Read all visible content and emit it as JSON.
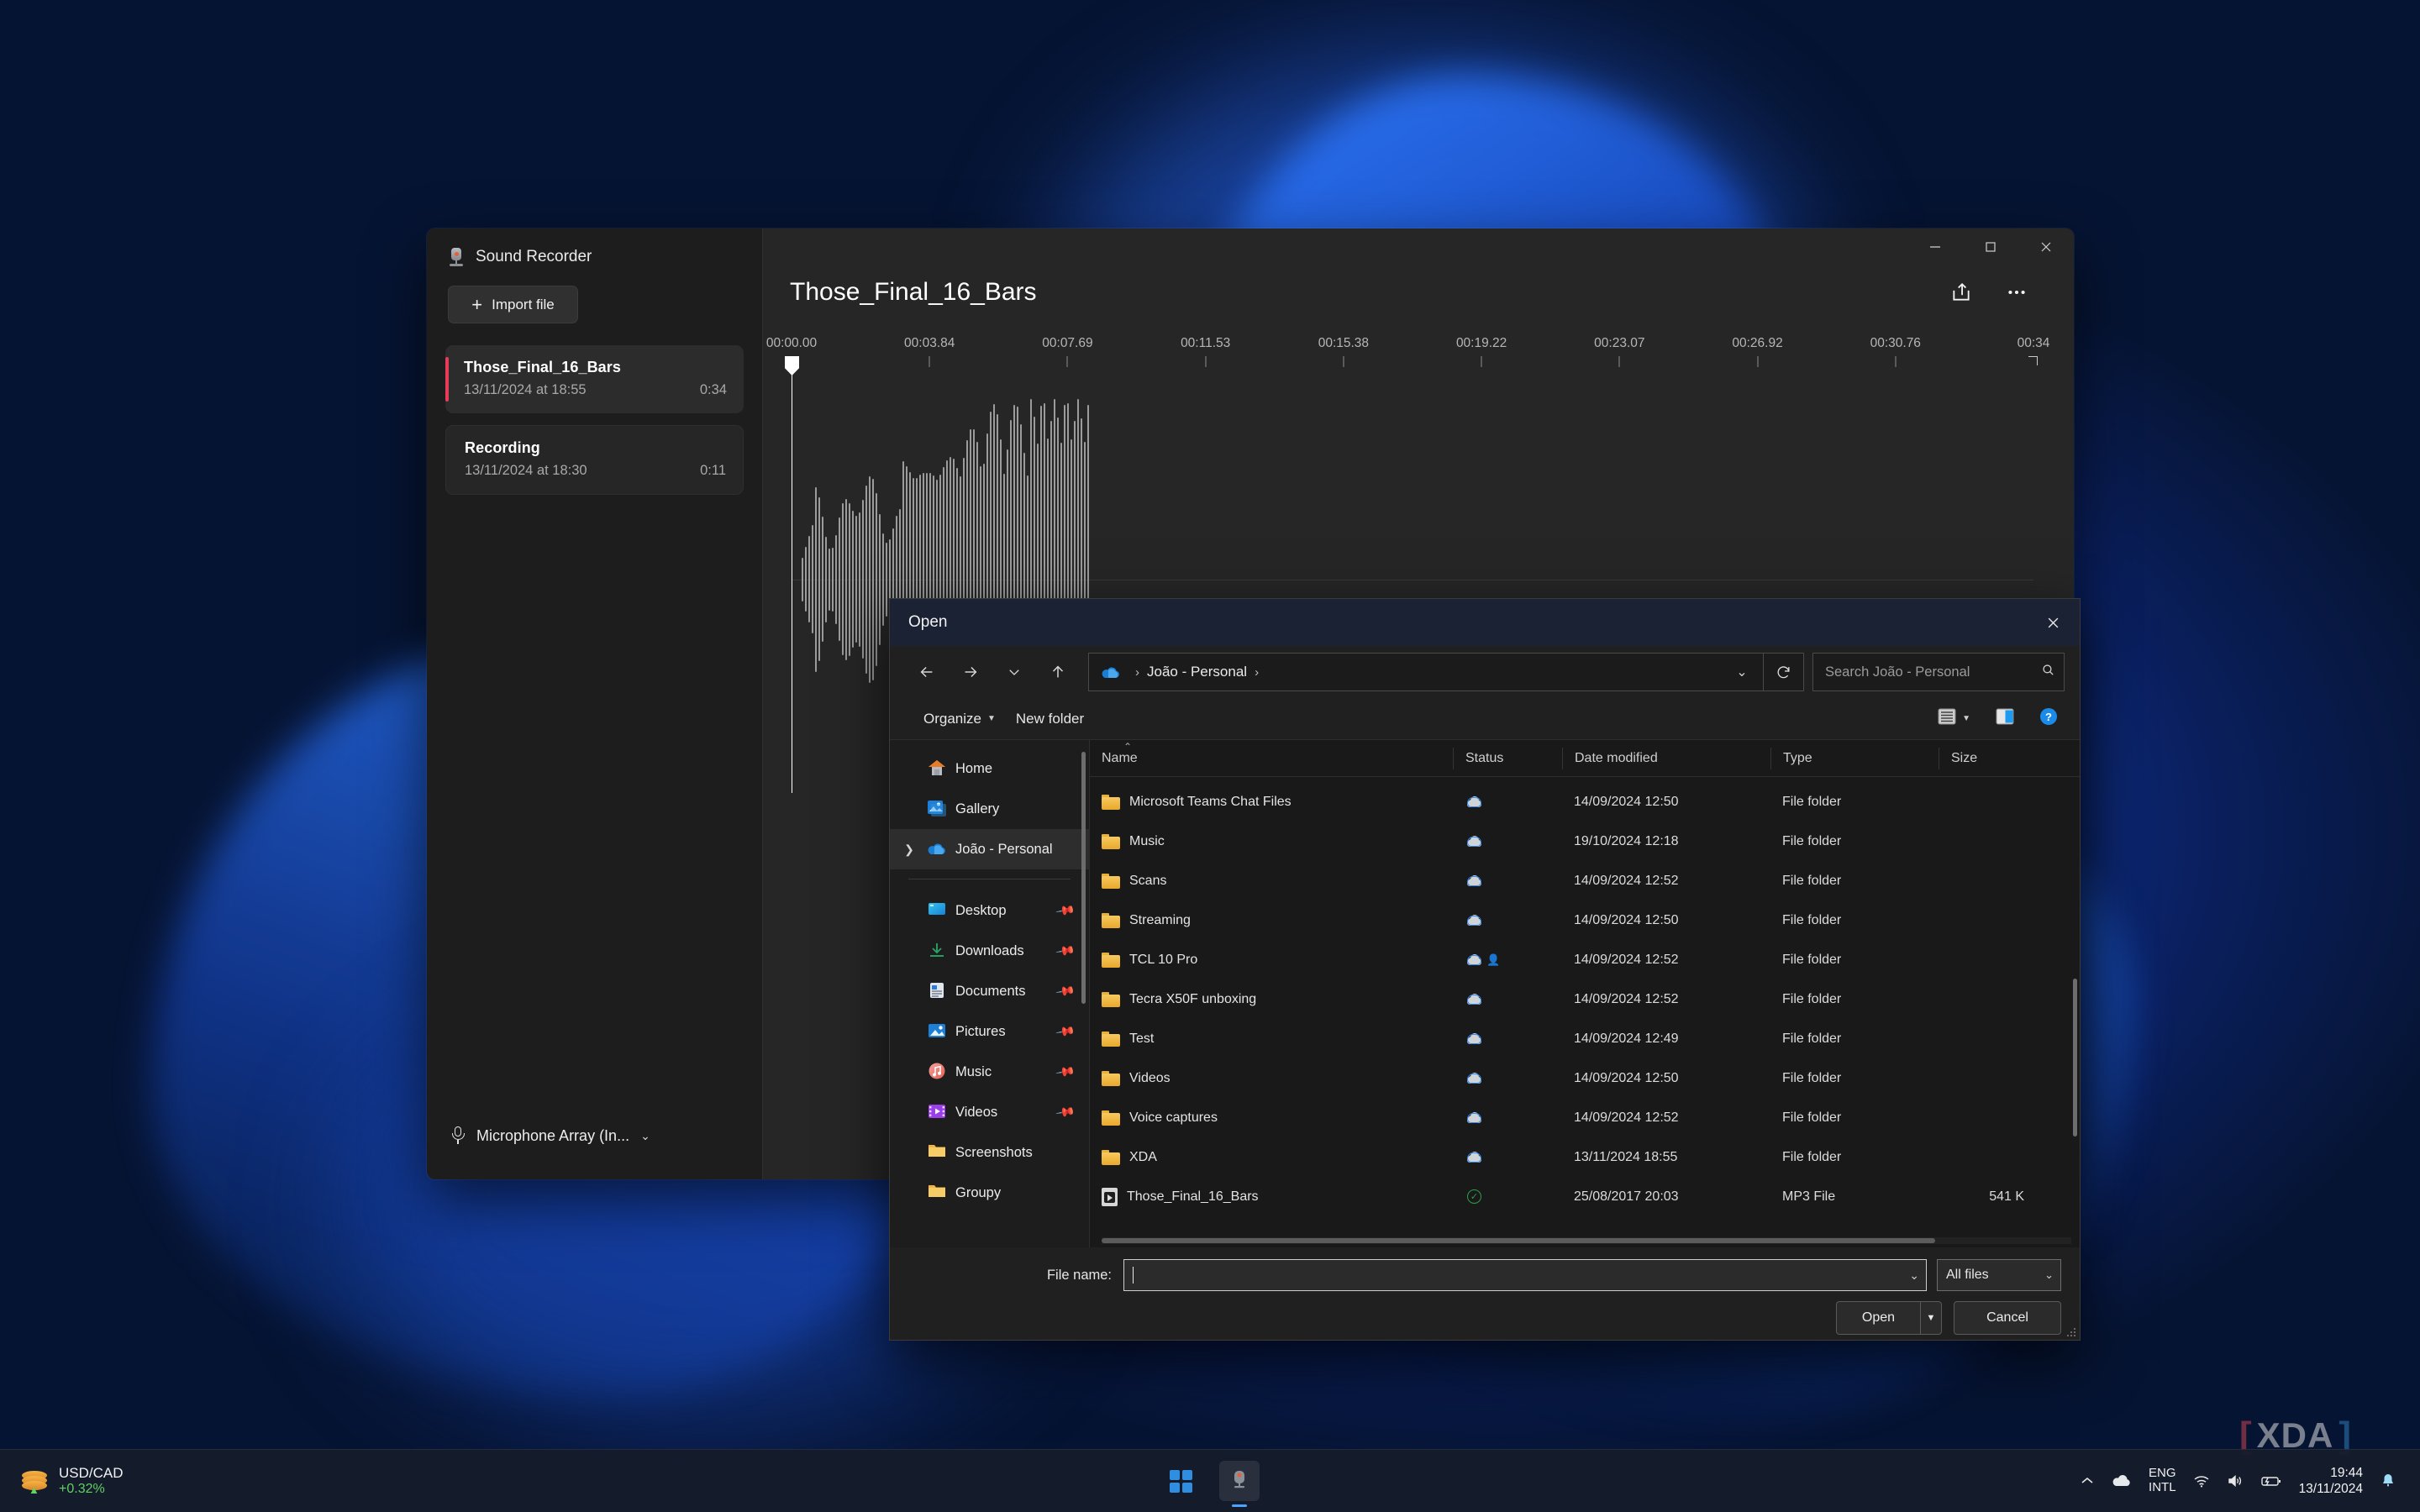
{
  "recorder": {
    "app_title": "Sound Recorder",
    "import_label": "Import file",
    "recordings": [
      {
        "name": "Those_Final_16_Bars",
        "date": "13/11/2024 at 18:55",
        "duration": "0:34",
        "selected": true
      },
      {
        "name": "Recording",
        "date": "13/11/2024 at 18:30",
        "duration": "0:11",
        "selected": false
      }
    ],
    "file_title": "Those_Final_16_Bars",
    "microphone": "Microphone Array (In...",
    "share_icon": "share-icon",
    "more_icon": "more-options-icon",
    "window_controls": {
      "minimize": "minimize-icon",
      "maximize": "maximize-icon",
      "close": "close-icon"
    },
    "timeline_ticks": [
      "00:00.00",
      "00:03.84",
      "00:07.69",
      "00:11.53",
      "00:15.38",
      "00:19.22",
      "00:23.07",
      "00:26.92",
      "00:30.76",
      "00:34"
    ]
  },
  "dialog": {
    "title": "Open",
    "close_icon": "close-icon",
    "nav": {
      "back_icon": "arrow-left-icon",
      "forward_icon": "arrow-right-icon",
      "recent_icon": "chevron-down-icon",
      "up_icon": "arrow-up-icon"
    },
    "address": {
      "cloud_icon": "onedrive-icon",
      "path": "João - Personal",
      "chevron": "chevron-down-icon"
    },
    "refresh_icon": "refresh-icon",
    "search": {
      "placeholder": "Search João - Personal",
      "icon": "search-icon"
    },
    "toolbar": {
      "organize": "Organize",
      "new_folder": "New folder",
      "view_icon": "list-view-icon",
      "preview_icon": "preview-pane-icon",
      "help_icon": "help-icon"
    },
    "tree": [
      {
        "label": "Home",
        "icon": "home-icon",
        "expand": false,
        "pinned": false,
        "active": false
      },
      {
        "label": "Gallery",
        "icon": "gallery-icon",
        "expand": false,
        "pinned": false,
        "active": false
      },
      {
        "label": "João - Personal",
        "icon": "onedrive-icon",
        "expand": true,
        "pinned": false,
        "active": true
      },
      {
        "separator": true
      },
      {
        "label": "Desktop",
        "icon": "desktop-icon",
        "expand": false,
        "pinned": true,
        "active": false
      },
      {
        "label": "Downloads",
        "icon": "downloads-icon",
        "expand": false,
        "pinned": true,
        "active": false
      },
      {
        "label": "Documents",
        "icon": "documents-icon",
        "expand": false,
        "pinned": true,
        "active": false
      },
      {
        "label": "Pictures",
        "icon": "pictures-icon",
        "expand": false,
        "pinned": true,
        "active": false
      },
      {
        "label": "Music",
        "icon": "music-icon",
        "expand": false,
        "pinned": true,
        "active": false
      },
      {
        "label": "Videos",
        "icon": "videos-icon",
        "expand": false,
        "pinned": true,
        "active": false
      },
      {
        "label": "Screenshots",
        "icon": "folder-icon",
        "expand": false,
        "pinned": false,
        "active": false
      },
      {
        "label": "Groupy",
        "icon": "folder-icon",
        "expand": false,
        "pinned": false,
        "active": false
      }
    ],
    "columns": [
      "Name",
      "Status",
      "Date modified",
      "Type",
      "Size"
    ],
    "sort_indicator": "sort-ascending-icon",
    "files": [
      {
        "name": "Microsoft Teams Chat Files",
        "icon": "folder-icon",
        "status": "cloud",
        "shared": false,
        "date": "14/09/2024 12:50",
        "type": "File folder",
        "size": ""
      },
      {
        "name": "Music",
        "icon": "folder-icon",
        "status": "cloud",
        "shared": false,
        "date": "19/10/2024 12:18",
        "type": "File folder",
        "size": ""
      },
      {
        "name": "Scans",
        "icon": "folder-icon",
        "status": "cloud",
        "shared": false,
        "date": "14/09/2024 12:52",
        "type": "File folder",
        "size": ""
      },
      {
        "name": "Streaming",
        "icon": "folder-icon",
        "status": "cloud",
        "shared": false,
        "date": "14/09/2024 12:50",
        "type": "File folder",
        "size": ""
      },
      {
        "name": "TCL 10 Pro",
        "icon": "folder-icon",
        "status": "cloud",
        "shared": true,
        "date": "14/09/2024 12:52",
        "type": "File folder",
        "size": ""
      },
      {
        "name": "Tecra X50F unboxing",
        "icon": "folder-icon",
        "status": "cloud",
        "shared": false,
        "date": "14/09/2024 12:52",
        "type": "File folder",
        "size": ""
      },
      {
        "name": "Test",
        "icon": "folder-icon",
        "status": "cloud",
        "shared": false,
        "date": "14/09/2024 12:49",
        "type": "File folder",
        "size": ""
      },
      {
        "name": "Videos",
        "icon": "folder-icon",
        "status": "cloud",
        "shared": false,
        "date": "14/09/2024 12:50",
        "type": "File folder",
        "size": ""
      },
      {
        "name": "Voice captures",
        "icon": "folder-icon",
        "status": "cloud",
        "shared": false,
        "date": "14/09/2024 12:52",
        "type": "File folder",
        "size": ""
      },
      {
        "name": "XDA",
        "icon": "folder-icon",
        "status": "cloud",
        "shared": false,
        "date": "13/11/2024 18:55",
        "type": "File folder",
        "size": ""
      },
      {
        "name": "Those_Final_16_Bars",
        "icon": "mp3-icon",
        "status": "available",
        "shared": false,
        "date": "25/08/2017 20:03",
        "type": "MP3 File",
        "size": "541 K"
      }
    ],
    "footer": {
      "file_name_label": "File name:",
      "file_name_value": "",
      "filter_value": "All files",
      "open_label": "Open",
      "open_split_icon": "chevron-down-icon",
      "cancel_label": "Cancel"
    }
  },
  "taskbar": {
    "widget": {
      "title": "USD/CAD",
      "change": "+0.32%",
      "icon": "coins-icon",
      "trend_icon": "arrow-up-icon"
    },
    "start_icon": "windows-start-icon",
    "apps": [
      {
        "name": "sound-recorder-taskbar-icon",
        "active": true
      }
    ],
    "tray": {
      "overflow_icon": "chevron-up-icon",
      "onedrive_icon": "onedrive-icon",
      "language_line1": "ENG",
      "language_line2": "INTL",
      "wifi_icon": "wifi-icon",
      "volume_icon": "volume-icon",
      "battery_icon": "battery-charging-icon",
      "notification_icon": "notification-bell-icon"
    },
    "clock": {
      "time": "19:44",
      "date": "13/11/2024"
    }
  },
  "watermark": {
    "left_bracket": "[",
    "text": "XDA",
    "right_bracket": "]"
  },
  "colors": {
    "accent_red": "#e63c5a",
    "accent_blue": "#2f8ee0",
    "positive_green": "#62cf62",
    "dialog_title_bg": "#1b2233"
  }
}
